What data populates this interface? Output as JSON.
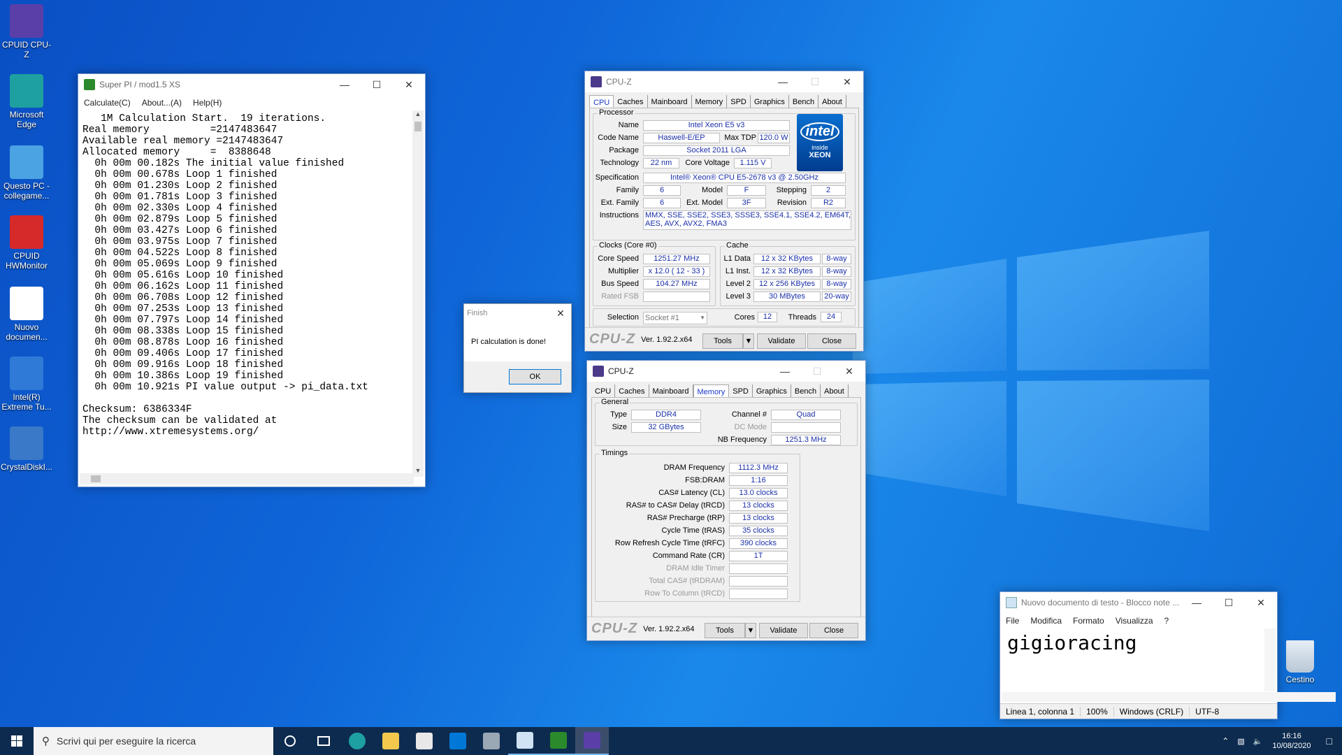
{
  "desktop": {
    "icons": [
      {
        "label": "CPUID CPU-Z",
        "icon": "cpu-z-icon",
        "color": "#5b3fa8"
      },
      {
        "label": "Microsoft Edge",
        "icon": "edge-icon",
        "color": "#1fa0a0"
      },
      {
        "label": "Questo PC - collegame...",
        "icon": "computer-icon",
        "color": "#4ba3e3"
      },
      {
        "label": "CPUID HWMonitor",
        "icon": "hwmonitor-icon",
        "color": "#d62a2a"
      },
      {
        "label": "Nuovo documen...",
        "icon": "document-icon",
        "color": "#ffffff"
      },
      {
        "label": "Intel(R) Extreme Tu...",
        "icon": "xtu-icon",
        "color": "#2f7ad6"
      },
      {
        "label": "CrystalDiskI...",
        "icon": "crystaldisk-icon",
        "color": "#3a78c8"
      }
    ],
    "recycle_label": "Cestino"
  },
  "superpi": {
    "title": "Super PI / mod1.5 XS",
    "menu": [
      "Calculate(C)",
      "About...(A)",
      "Help(H)"
    ],
    "output": "   1M Calculation Start.  19 iterations.\nReal memory          =2147483647\nAvailable real memory =2147483647\nAllocated memory     =  8388648\n  0h 00m 00.182s The initial value finished\n  0h 00m 00.678s Loop 1 finished\n  0h 00m 01.230s Loop 2 finished\n  0h 00m 01.781s Loop 3 finished\n  0h 00m 02.330s Loop 4 finished\n  0h 00m 02.879s Loop 5 finished\n  0h 00m 03.427s Loop 6 finished\n  0h 00m 03.975s Loop 7 finished\n  0h 00m 04.522s Loop 8 finished\n  0h 00m 05.069s Loop 9 finished\n  0h 00m 05.616s Loop 10 finished\n  0h 00m 06.162s Loop 11 finished\n  0h 00m 06.708s Loop 12 finished\n  0h 00m 07.253s Loop 13 finished\n  0h 00m 07.797s Loop 14 finished\n  0h 00m 08.338s Loop 15 finished\n  0h 00m 08.878s Loop 16 finished\n  0h 00m 09.406s Loop 17 finished\n  0h 00m 09.916s Loop 18 finished\n  0h 00m 10.386s Loop 19 finished\n  0h 00m 10.921s PI value output -> pi_data.txt\n\nChecksum: 6386334F\nThe checksum can be validated at\nhttp://www.xtremesystems.org/"
  },
  "finish": {
    "title": "Finish",
    "message": "PI calculation is done!",
    "ok": "OK"
  },
  "cpuz_cpu": {
    "title": "CPU-Z",
    "tabs": [
      "CPU",
      "Caches",
      "Mainboard",
      "Memory",
      "SPD",
      "Graphics",
      "Bench",
      "About"
    ],
    "processor_label": "Processor",
    "name_l": "Name",
    "name": "Intel Xeon E5 v3",
    "codename_l": "Code Name",
    "codename": "Haswell-E/EP",
    "maxtdp_l": "Max TDP",
    "maxtdp": "120.0 W",
    "package_l": "Package",
    "package": "Socket 2011 LGA",
    "tech_l": "Technology",
    "tech": "22 nm",
    "corev_l": "Core Voltage",
    "corev": "1.115 V",
    "spec_l": "Specification",
    "spec": "Intel® Xeon® CPU E5-2678 v3 @ 2.50GHz",
    "family_l": "Family",
    "family": "6",
    "model_l": "Model",
    "model": "F",
    "stepping_l": "Stepping",
    "stepping": "2",
    "extfam_l": "Ext. Family",
    "extfam": "6",
    "extmodel_l": "Ext. Model",
    "extmodel": "3F",
    "revision_l": "Revision",
    "revision": "R2",
    "instr_l": "Instructions",
    "instr1": "MMX, SSE, SSE2, SSE3, SSSE3, SSE4.1, SSE4.2, EM64T, VT-x,",
    "instr2": "AES, AVX, AVX2, FMA3",
    "badge_top": "intel",
    "badge_mid": "inside",
    "badge_bot": "XEON",
    "clocks_label": "Clocks (Core #0)",
    "corespeed_l": "Core Speed",
    "corespeed": "1251.27 MHz",
    "mult_l": "Multiplier",
    "mult": "x 12.0 ( 12 - 33 )",
    "bus_l": "Bus Speed",
    "bus": "104.27 MHz",
    "fsb_l": "Rated FSB",
    "cache_label": "Cache",
    "l1d_l": "L1 Data",
    "l1d": "12 x 32 KBytes",
    "l1d_w": "8-way",
    "l1i_l": "L1 Inst.",
    "l1i": "12 x 32 KBytes",
    "l1i_w": "8-way",
    "l2_l": "Level 2",
    "l2": "12 x 256 KBytes",
    "l2_w": "8-way",
    "l3_l": "Level 3",
    "l3": "30 MBytes",
    "l3_w": "20-way",
    "selection_l": "Selection",
    "selection": "Socket #1",
    "cores_l": "Cores",
    "cores": "12",
    "threads_l": "Threads",
    "threads": "24",
    "logo": "CPU-Z",
    "version": "Ver. 1.92.2.x64",
    "tools": "Tools",
    "validate": "Validate",
    "close": "Close"
  },
  "cpuz_mem": {
    "title": "CPU-Z",
    "tabs": [
      "CPU",
      "Caches",
      "Mainboard",
      "Memory",
      "SPD",
      "Graphics",
      "Bench",
      "About"
    ],
    "general_label": "General",
    "type_l": "Type",
    "type": "DDR4",
    "size_l": "Size",
    "size": "32 GBytes",
    "channel_l": "Channel #",
    "channel": "Quad",
    "dcmode_l": "DC Mode",
    "nbfreq_l": "NB Frequency",
    "nbfreq": "1251.3 MHz",
    "timings_label": "Timings",
    "timings": [
      {
        "l": "DRAM Frequency",
        "v": "1112.3 MHz"
      },
      {
        "l": "FSB:DRAM",
        "v": "1:16"
      },
      {
        "l": "CAS# Latency (CL)",
        "v": "13.0 clocks"
      },
      {
        "l": "RAS# to CAS# Delay (tRCD)",
        "v": "13 clocks"
      },
      {
        "l": "RAS# Precharge (tRP)",
        "v": "13 clocks"
      },
      {
        "l": "Cycle Time (tRAS)",
        "v": "35 clocks"
      },
      {
        "l": "Row Refresh Cycle Time (tRFC)",
        "v": "390 clocks"
      },
      {
        "l": "Command Rate (CR)",
        "v": "1T"
      },
      {
        "l": "DRAM Idle Timer",
        "v": ""
      },
      {
        "l": "Total CAS# (tRDRAM)",
        "v": ""
      },
      {
        "l": "Row To Column (tRCD)",
        "v": ""
      }
    ],
    "logo": "CPU-Z",
    "version": "Ver. 1.92.2.x64",
    "tools": "Tools",
    "validate": "Validate",
    "close": "Close"
  },
  "notepad": {
    "title": "Nuovo documento di testo - Blocco note ...",
    "menu": [
      "File",
      "Modifica",
      "Formato",
      "Visualizza",
      "?"
    ],
    "content": "gigioracing",
    "status": [
      "Linea 1, colonna 1",
      "100%",
      "Windows (CRLF)",
      "UTF-8"
    ]
  },
  "taskbar": {
    "search_placeholder": "Scrivi qui per eseguire la ricerca",
    "time": "16:16",
    "date": "10/08/2020"
  }
}
